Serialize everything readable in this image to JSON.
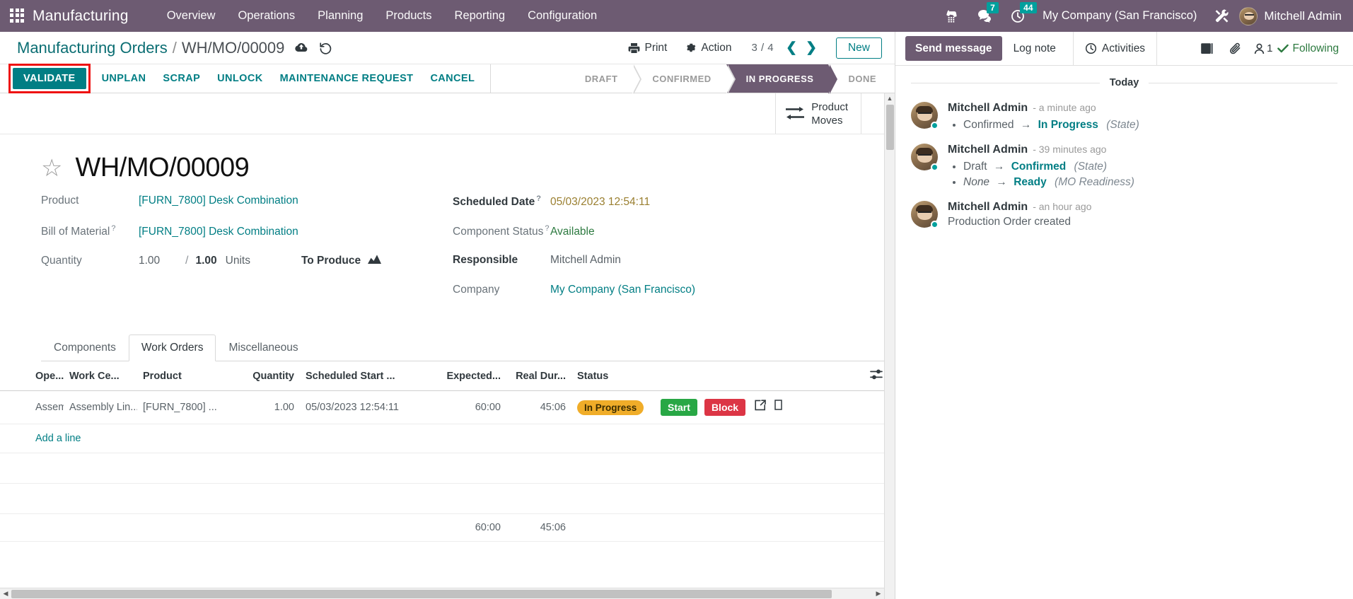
{
  "navbar": {
    "apps_icon": "apps-grid-icon",
    "brand": "Manufacturing",
    "menus": [
      "Overview",
      "Operations",
      "Planning",
      "Products",
      "Reporting",
      "Configuration"
    ],
    "phone_icon": "phone-icon",
    "messages_icon": "messages-icon",
    "messages_count": "7",
    "activities_icon": "clock-icon",
    "activities_count": "44",
    "company": "My Company (San Francisco)",
    "tools_icon": "tools-icon",
    "user_name": "Mitchell Admin"
  },
  "control_panel": {
    "breadcrumb_parent": "Manufacturing Orders",
    "breadcrumb_sep": "/",
    "breadcrumb_current": "WH/MO/00009",
    "save_icon": "cloud-save-icon",
    "discard_icon": "undo-discard-icon",
    "print_label": "Print",
    "print_icon": "printer-icon",
    "action_label": "Action",
    "action_icon": "gear-icon",
    "pager_value": "3 / 4",
    "prev_icon": "chevron-left-icon",
    "next_icon": "chevron-right-icon",
    "new_label": "New"
  },
  "action_bar": {
    "buttons": [
      {
        "label": "VALIDATE",
        "style": "primary",
        "highlighted": true
      },
      {
        "label": "UNPLAN",
        "style": "text"
      },
      {
        "label": "SCRAP",
        "style": "text"
      },
      {
        "label": "UNLOCK",
        "style": "text"
      },
      {
        "label": "MAINTENANCE REQUEST",
        "style": "text"
      },
      {
        "label": "CANCEL",
        "style": "text"
      }
    ],
    "statuses": [
      {
        "label": "DRAFT",
        "active": false
      },
      {
        "label": "CONFIRMED",
        "active": false
      },
      {
        "label": "IN PROGRESS",
        "active": true
      },
      {
        "label": "DONE",
        "active": false
      }
    ]
  },
  "smart_button": {
    "icon": "product-moves-arrows-icon",
    "line1": "Product",
    "line2": "Moves"
  },
  "form": {
    "star_icon": "star-favorite-icon",
    "title": "WH/MO/00009",
    "left_fields": [
      {
        "label": "Product",
        "value": "[FURN_7800] Desk Combination",
        "help": false
      },
      {
        "label": "Bill of Material",
        "value": "[FURN_7800] Desk Combination",
        "help": true
      }
    ],
    "quantity": {
      "label": "Quantity",
      "done": "1.00",
      "separator": "/",
      "total": "1.00",
      "uom": "Units",
      "to_produce_label": "To Produce",
      "to_produce_icon": "forecast-chart-icon"
    },
    "right_fields": [
      {
        "label": "Scheduled Date",
        "value": "05/03/2023 12:54:11",
        "help": true,
        "kind": "date"
      },
      {
        "label": "Component Status",
        "value": "Available",
        "help": true,
        "kind": "green"
      },
      {
        "label": "Responsible",
        "value": "Mitchell Admin",
        "help": false,
        "kind": "plain",
        "bold": true
      },
      {
        "label": "Company",
        "value": "My Company (San Francisco)",
        "help": false,
        "kind": "link"
      }
    ]
  },
  "notebook": {
    "tabs": [
      {
        "label": "Components",
        "active": false
      },
      {
        "label": "Work Orders",
        "active": true
      },
      {
        "label": "Miscellaneous",
        "active": false
      }
    ],
    "optional_columns_icon": "column-settings-icon"
  },
  "work_orders": {
    "columns": [
      "Ope...",
      "Work Ce...",
      "Product",
      "Quantity",
      "Scheduled Start ...",
      "Expected...",
      "Real Dur...",
      "Status"
    ],
    "rows": [
      {
        "operation": "Assembly",
        "work_center": "Assembly Lin...",
        "product": "[FURN_7800] ...",
        "quantity": "1.00",
        "scheduled_start": "05/03/2023 12:54:11",
        "expected_duration": "60:00",
        "real_duration": "45:06",
        "status": "In Progress",
        "start_label": "Start",
        "block_label": "Block",
        "open_icon": "open-record-icon",
        "copy_icon": "duplicate-row-icon"
      }
    ],
    "add_line_label": "Add a line",
    "totals": {
      "expected_duration": "60:00",
      "real_duration": "45:06"
    }
  },
  "chatter": {
    "send_message_label": "Send message",
    "log_note_label": "Log note",
    "activities_label": "Activities",
    "activities_icon": "clock-icon",
    "attachments_icon": "paperclip-icon",
    "knowledge_icon": "book-icon",
    "followers_icon": "user-icon",
    "followers_count": "1",
    "following_label": "Following",
    "following_icon": "check-icon",
    "day_separator": "Today",
    "messages": [
      {
        "author": "Mitchell Admin",
        "date": "- a minute ago",
        "tracking": [
          {
            "old": "Confirmed",
            "old_italic": false,
            "arrow": "→",
            "new": "In Progress",
            "field": "(State)"
          }
        ]
      },
      {
        "author": "Mitchell Admin",
        "date": "- 39 minutes ago",
        "tracking": [
          {
            "old": "Draft",
            "old_italic": false,
            "arrow": "→",
            "new": "Confirmed",
            "field": "(State)"
          },
          {
            "old": "None",
            "old_italic": true,
            "arrow": "→",
            "new": "Ready",
            "field": "(MO Readiness)"
          }
        ]
      },
      {
        "author": "Mitchell Admin",
        "date": "- an hour ago",
        "body": "Production Order created"
      }
    ]
  },
  "colors": {
    "brand_purple": "#6d5b72",
    "teal": "#017e84",
    "badge_teal": "#00a09d",
    "highlight_red": "#ee1111",
    "status_amber": "#f0ad29",
    "start_green": "#28a745",
    "block_red": "#dc3545"
  }
}
